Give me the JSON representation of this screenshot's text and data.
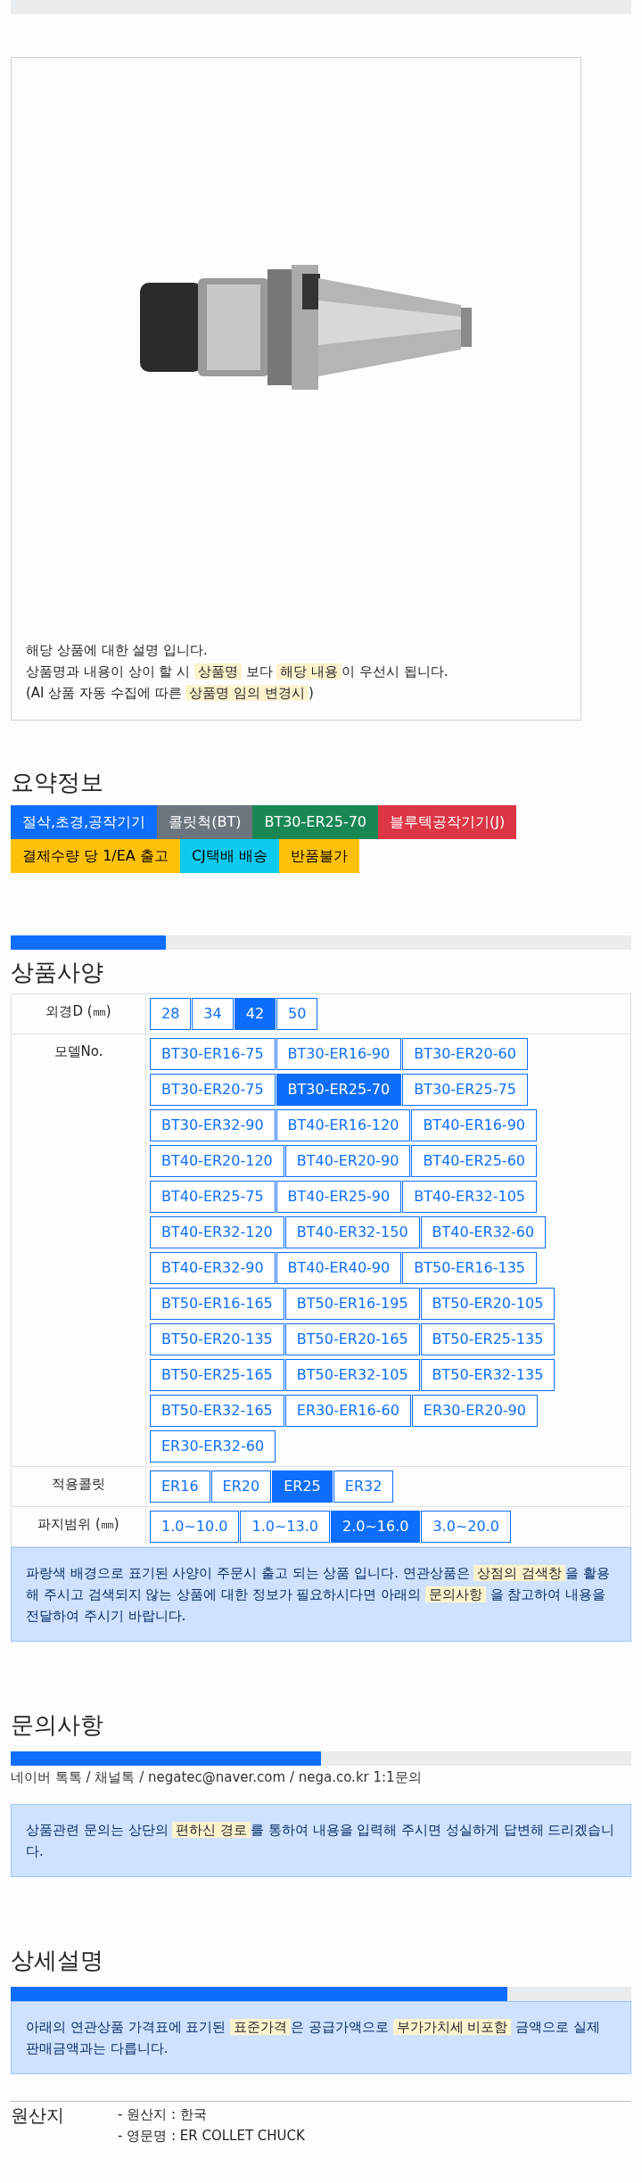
{
  "product": {
    "notes": [
      "해당 상품에 대한 설명 입니다.",
      "상품명과 내용이 상이 할 시 **상품명** 보다 **해당 내용**이 우선시 됩니다.",
      "(AI 상품 자동 수집에 따른 **상품명 임의 변경시**)"
    ]
  },
  "summary": {
    "title": "요약정보",
    "badges": [
      {
        "label": "절삭,초경,공작기기",
        "color": "#0d6efd"
      },
      {
        "label": "콜릿척(BT)",
        "color": "#6c757d"
      },
      {
        "label": "BT30-ER25-70",
        "color": "#198754"
      },
      {
        "label": "블루텍공작기기(J)",
        "color": "#dc3545"
      },
      {
        "label": "결제수량 당 1/EA 출고",
        "color": "#ffc107"
      },
      {
        "label": "CJ택배 배송",
        "color": "#0dcaf0"
      },
      {
        "label": "반품불가",
        "color": "#ffc107"
      }
    ]
  },
  "spec": {
    "progress": {
      "level": 0.25
    },
    "title": "상품사양",
    "rows": [
      {
        "label": "외경D (㎜)",
        "options": [
          {
            "label": "28",
            "selected": false
          },
          {
            "label": "34",
            "selected": false
          },
          {
            "label": "42",
            "selected": true
          },
          {
            "label": "50",
            "selected": false
          }
        ]
      },
      {
        "label": "모델No.",
        "options": [
          {
            "label": "BT30-ER16-75",
            "selected": false
          },
          {
            "label": "BT30-ER16-90",
            "selected": false
          },
          {
            "label": "BT30-ER20-60",
            "selected": false
          },
          {
            "label": "BT30-ER20-75",
            "selected": false
          },
          {
            "label": "BT30-ER25-70",
            "selected": true
          },
          {
            "label": "BT30-ER25-75",
            "selected": false
          },
          {
            "label": "BT30-ER32-90",
            "selected": false
          },
          {
            "label": "BT40-ER16-120",
            "selected": false
          },
          {
            "label": "BT40-ER16-90",
            "selected": false
          },
          {
            "label": "BT40-ER20-120",
            "selected": false
          },
          {
            "label": "BT40-ER20-90",
            "selected": false
          },
          {
            "label": "BT40-ER25-60",
            "selected": false
          },
          {
            "label": "BT40-ER25-75",
            "selected": false
          },
          {
            "label": "BT40-ER25-90",
            "selected": false
          },
          {
            "label": "BT40-ER32-105",
            "selected": false
          },
          {
            "label": "BT40-ER32-120",
            "selected": false
          },
          {
            "label": "BT40-ER32-150",
            "selected": false
          },
          {
            "label": "BT40-ER32-60",
            "selected": false
          },
          {
            "label": "BT40-ER32-90",
            "selected": false
          },
          {
            "label": "BT40-ER40-90",
            "selected": false
          },
          {
            "label": "BT50-ER16-135",
            "selected": false
          },
          {
            "label": "BT50-ER16-165",
            "selected": false
          },
          {
            "label": "BT50-ER16-195",
            "selected": false
          },
          {
            "label": "BT50-ER20-105",
            "selected": false
          },
          {
            "label": "BT50-ER20-135",
            "selected": false
          },
          {
            "label": "BT50-ER20-165",
            "selected": false
          },
          {
            "label": "BT50-ER25-135",
            "selected": false
          },
          {
            "label": "BT50-ER25-165",
            "selected": false
          },
          {
            "label": "BT50-ER32-105",
            "selected": false
          },
          {
            "label": "BT50-ER32-135",
            "selected": false
          },
          {
            "label": "BT50-ER32-165",
            "selected": false
          },
          {
            "label": "ER30-ER16-60",
            "selected": false
          },
          {
            "label": "ER30-ER20-90",
            "selected": false
          },
          {
            "label": "ER30-ER32-60",
            "selected": false
          }
        ]
      },
      {
        "label": "적용콜릿",
        "options": [
          {
            "label": "ER16",
            "selected": false
          },
          {
            "label": "ER20",
            "selected": false
          },
          {
            "label": "ER25",
            "selected": true
          },
          {
            "label": "ER32",
            "selected": false
          }
        ]
      },
      {
        "label": "파지범위 (㎜)",
        "options": [
          {
            "label": "1.0~10.0",
            "selected": false
          },
          {
            "label": "1.0~13.0",
            "selected": false
          },
          {
            "label": "2.0~16.0",
            "selected": true
          },
          {
            "label": "3.0~20.0",
            "selected": false
          }
        ]
      }
    ],
    "notice": "파랑색 배경으로 표기된 사양이 주문시 출고 되는 상품 입니다. 연관상품은 **상점의 검색창**을 활용해 주시고 검색되지 않는 상품에 대한 정보가 필요하시다면 아래의 **문의사항** 을 참고하여 내용을 전달하여 주시기 바랍니다."
  },
  "inquiry": {
    "title": "문의사항",
    "progress": {
      "level": 0.5
    },
    "contacts": "네이버 톡톡 / 채널톡 / negatec@naver.com / nega.co.kr 1:1문의",
    "notice": "상품관련 문의는 상단의 **편하신 경로**를 통하여 내용을 입력해 주시면 성실하게 답변해 드리겠습니다."
  },
  "detail": {
    "title": "상세설명",
    "progress": {
      "level": 0.8
    },
    "notice": "아래의 연관상품 가격표에 표기된 **표준가격**은 공급가액으로 **부가가치세 비포함** 금액으로 실제 판매금액과는 다릅니다.",
    "origin": {
      "label": "원산지",
      "lines": [
        "- 원산지 : 한국",
        "- 영문명 : ER COLLET CHUCK"
      ]
    }
  }
}
